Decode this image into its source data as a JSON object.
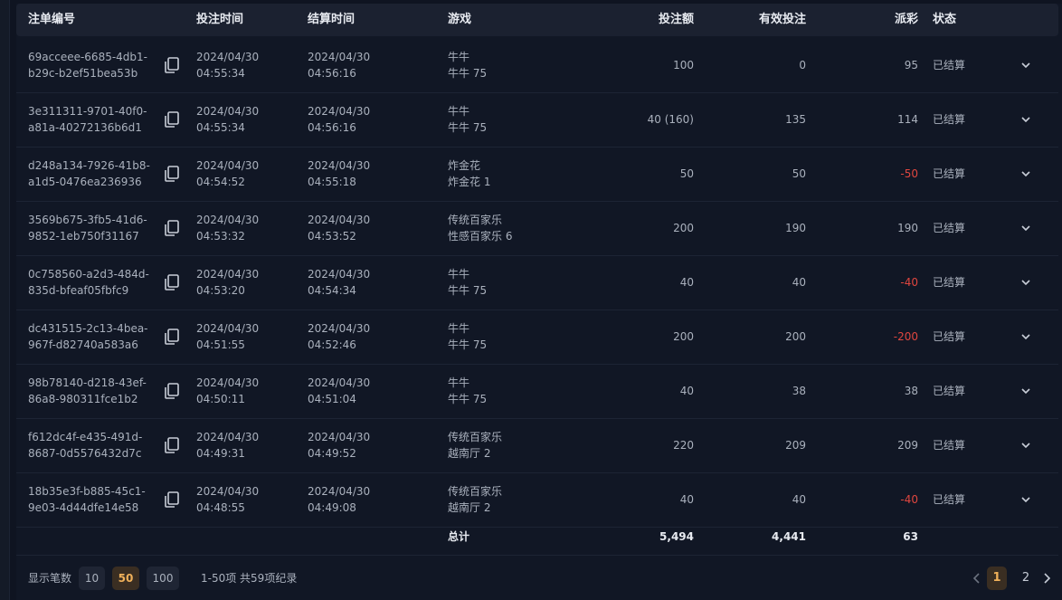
{
  "headers": {
    "order_id": "注单编号",
    "bet_time": "投注时间",
    "settle_time": "结算时间",
    "game": "游戏",
    "bet_amount": "投注额",
    "valid_bet": "有效投注",
    "payout": "派彩",
    "status": "状态"
  },
  "rows": [
    {
      "id1": "69acceee-6685-4db1-",
      "id2": "b29c-b2ef51bea53b",
      "bd": "2024/04/30",
      "bt": "04:55:34",
      "sd": "2024/04/30",
      "st": "04:56:16",
      "g1": "牛牛",
      "g2": "牛牛 75",
      "bet": "100",
      "valid": "0",
      "payout": "95",
      "neg": false,
      "status": "已结算"
    },
    {
      "id1": "3e311311-9701-40f0-",
      "id2": "a81a-40272136b6d1",
      "bd": "2024/04/30",
      "bt": "04:55:34",
      "sd": "2024/04/30",
      "st": "04:56:16",
      "g1": "牛牛",
      "g2": "牛牛 75",
      "bet": "40 (160)",
      "valid": "135",
      "payout": "114",
      "neg": false,
      "status": "已结算"
    },
    {
      "id1": "d248a134-7926-41b8-",
      "id2": "a1d5-0476ea236936",
      "bd": "2024/04/30",
      "bt": "04:54:52",
      "sd": "2024/04/30",
      "st": "04:55:18",
      "g1": "炸金花",
      "g2": "炸金花 1",
      "bet": "50",
      "valid": "50",
      "payout": "-50",
      "neg": true,
      "status": "已结算"
    },
    {
      "id1": "3569b675-3fb5-41d6-",
      "id2": "9852-1eb750f31167",
      "bd": "2024/04/30",
      "bt": "04:53:32",
      "sd": "2024/04/30",
      "st": "04:53:52",
      "g1": "传统百家乐",
      "g2": "性感百家乐 6",
      "bet": "200",
      "valid": "190",
      "payout": "190",
      "neg": false,
      "status": "已结算"
    },
    {
      "id1": "0c758560-a2d3-484d-",
      "id2": "835d-bfeaf05fbfc9",
      "bd": "2024/04/30",
      "bt": "04:53:20",
      "sd": "2024/04/30",
      "st": "04:54:34",
      "g1": "牛牛",
      "g2": "牛牛 75",
      "bet": "40",
      "valid": "40",
      "payout": "-40",
      "neg": true,
      "status": "已结算"
    },
    {
      "id1": "dc431515-2c13-4bea-",
      "id2": "967f-d82740a583a6",
      "bd": "2024/04/30",
      "bt": "04:51:55",
      "sd": "2024/04/30",
      "st": "04:52:46",
      "g1": "牛牛",
      "g2": "牛牛 75",
      "bet": "200",
      "valid": "200",
      "payout": "-200",
      "neg": true,
      "status": "已结算"
    },
    {
      "id1": "98b78140-d218-43ef-",
      "id2": "86a8-980311fce1b2",
      "bd": "2024/04/30",
      "bt": "04:50:11",
      "sd": "2024/04/30",
      "st": "04:51:04",
      "g1": "牛牛",
      "g2": "牛牛 75",
      "bet": "40",
      "valid": "38",
      "payout": "38",
      "neg": false,
      "status": "已结算"
    },
    {
      "id1": "f612dc4f-e435-491d-",
      "id2": "8687-0d5576432d7c",
      "bd": "2024/04/30",
      "bt": "04:49:31",
      "sd": "2024/04/30",
      "st": "04:49:52",
      "g1": "传统百家乐",
      "g2": "越南厅 2",
      "bet": "220",
      "valid": "209",
      "payout": "209",
      "neg": false,
      "status": "已结算"
    },
    {
      "id1": "18b35e3f-b885-45c1-",
      "id2": "9e03-4d44dfe14e58",
      "bd": "2024/04/30",
      "bt": "04:48:55",
      "sd": "2024/04/30",
      "st": "04:49:08",
      "g1": "传统百家乐",
      "g2": "越南厅 2",
      "bet": "40",
      "valid": "40",
      "payout": "-40",
      "neg": true,
      "status": "已结算"
    }
  ],
  "totals": {
    "label": "总计",
    "bet": "5,494",
    "valid": "4,441",
    "payout": "63"
  },
  "footer": {
    "page_size_label": "显示笔数",
    "page_sizes": [
      "10",
      "50",
      "100"
    ],
    "active_page_size": "50",
    "range_text": "1-50项 共59项纪录",
    "pages": [
      "1",
      "2"
    ],
    "current_page": "1"
  },
  "icons": {
    "copy": "copy-icon",
    "expand": "chevron-down-icon",
    "prev": "chevron-left-icon",
    "next": "chevron-right-icon"
  },
  "colors": {
    "negative": "#e0463f",
    "accent": "#f0b15a"
  }
}
